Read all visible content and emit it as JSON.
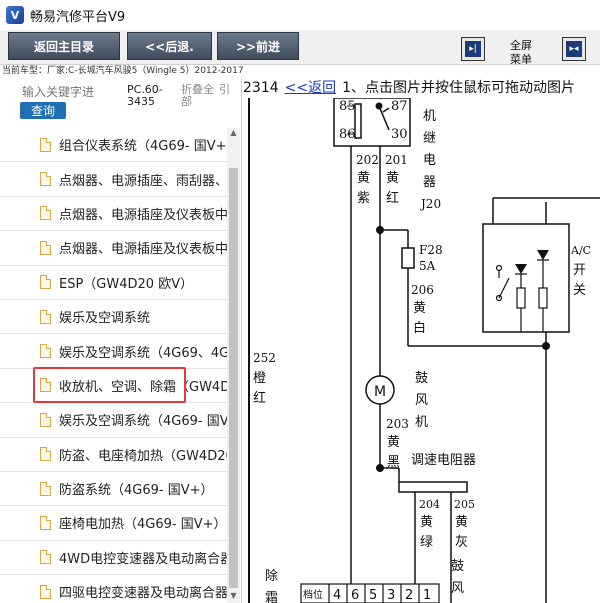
{
  "app": {
    "title": "畅易汽修平台V9",
    "icon_name": "app-logo-icon",
    "icon_glyph": "V"
  },
  "toolbar": {
    "home_label": "返回主目录",
    "back_label": "<<后退.",
    "forward_label": ">>前进",
    "fullscreen_label": "全屏\n菜单",
    "collapse_icon": "collapse-icon",
    "expand_icon": "expand-icon"
  },
  "car_model": "当前车型：厂家:C-长城汽车风骏5（Wingle 5）2012-2017",
  "search": {
    "placeholder": "输入关键字进",
    "button_label": "查询",
    "pc_code": "PC.60-3435",
    "fold_all": "折叠全部",
    "extra": "引"
  },
  "tree": {
    "items": [
      {
        "label": "组合仪表系统（4G69- 国V+）",
        "highlight": false
      },
      {
        "label": "点烟器、电源插座、雨刮器、",
        "highlight": false
      },
      {
        "label": "点烟器、电源插座及仪表板中",
        "highlight": false
      },
      {
        "label": "点烟器、电源插座及仪表板中",
        "highlight": false
      },
      {
        "label": "ESP（GW4D20 欧V）",
        "highlight": false
      },
      {
        "label": "娱乐及空调系统",
        "highlight": true
      },
      {
        "label": "娱乐及空调系统（4G69、4G",
        "highlight": false
      },
      {
        "label": "收放机、空调、除霜（GW4D2",
        "highlight": false
      },
      {
        "label": "娱乐及空调系统（4G69- 国V",
        "highlight": false
      },
      {
        "label": "防盗、电座椅加热（GW4D20",
        "highlight": false
      },
      {
        "label": "防盗系统（4G69- 国V+）",
        "highlight": false
      },
      {
        "label": "座椅电加热（4G69- 国V+）",
        "highlight": false
      },
      {
        "label": "4WD电控变速器及电动离合器",
        "highlight": false
      },
      {
        "label": "四驱电控变速器及电动离合器",
        "highlight": false
      }
    ]
  },
  "viewer": {
    "page_number": "2314",
    "back_link": "<<返回",
    "instruction": "1、点击图片并按住鼠标可拖动动图片"
  },
  "diagram": {
    "relay_pins": [
      "85",
      "87",
      "86",
      "30"
    ],
    "relay_label": [
      "机",
      "继",
      "电",
      "器",
      "J20"
    ],
    "wire_202": [
      "202",
      "黄",
      "紫"
    ],
    "wire_201": [
      "201",
      "黄",
      "红"
    ],
    "fuse": [
      "F28",
      "5A"
    ],
    "wire_206": [
      "206",
      "黄",
      "白"
    ],
    "wire_252": [
      "252",
      "橙",
      "红"
    ],
    "motor_label": "M",
    "blower_label": [
      "鼓",
      "风",
      "机"
    ],
    "wire_203": [
      "203",
      "黄",
      "黑"
    ],
    "resistor_label": "调速电阻器",
    "wire_204": [
      "204",
      "黄",
      "绿"
    ],
    "wire_205": [
      "205",
      "黄",
      "灰"
    ],
    "ac_switch_label": [
      "A/C",
      "开",
      "关"
    ],
    "gear_label": "档位",
    "gear_values": [
      "4",
      "6",
      "5",
      "3",
      "2",
      "1"
    ],
    "blower_switch_label": [
      "鼓",
      "风"
    ],
    "defrost_label": [
      "除",
      "霜"
    ]
  }
}
